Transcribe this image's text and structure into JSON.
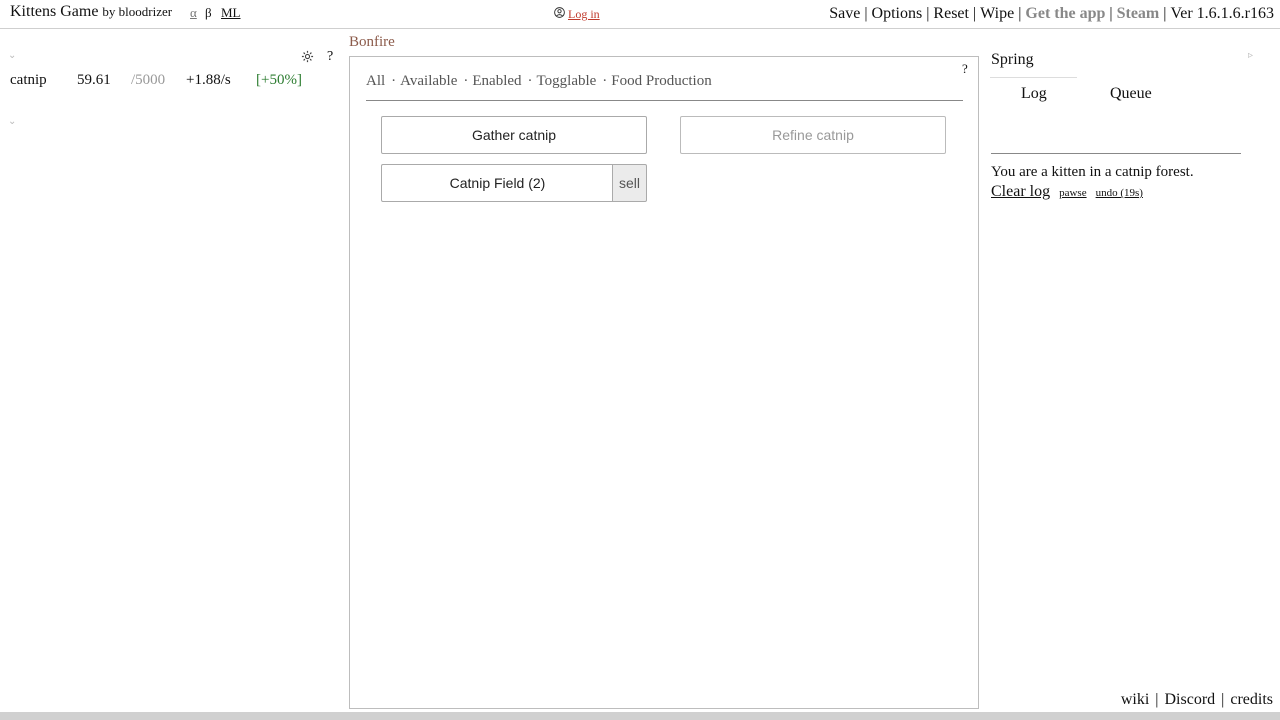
{
  "topbar": {
    "title": "Kittens Game",
    "by": "by bloodrizer",
    "alpha": "α",
    "beta": "β",
    "ml": "ML",
    "login": "Log in",
    "menu": {
      "save": "Save",
      "options": "Options",
      "reset": "Reset",
      "wipe": "Wipe",
      "get_app": "Get the app",
      "steam": "Steam",
      "version": "Ver 1.6.1.6.r163",
      "separator": "|"
    }
  },
  "left": {
    "help": "?",
    "resources": [
      {
        "name": "catnip",
        "value": "59.61",
        "max": "/5000",
        "rate": "+1.88/s",
        "bonus": "[+50%]"
      }
    ]
  },
  "bonfire": {
    "title": "Bonfire",
    "help": "?",
    "filters": [
      "All",
      "Available",
      "Enabled",
      "Togglable",
      "Food Production"
    ],
    "filter_separator": "·",
    "buttons": {
      "gather": "Gather catnip",
      "refine": "Refine catnip",
      "field": "Catnip Field (2)",
      "sell": "sell"
    }
  },
  "right": {
    "season": "Spring",
    "tabs": {
      "log": "Log",
      "queue": "Queue"
    },
    "log_message": "You are a kitten in a catnip forest.",
    "clear_log": "Clear log",
    "pawse": "pawse",
    "undo": "undo (19s)"
  },
  "footer": {
    "wiki": "wiki",
    "discord": "Discord",
    "credits": "credits",
    "separator": "|"
  },
  "colors": {
    "bonus_green": "#2e7d32",
    "login_red": "#c0392b",
    "title_brown": "#8b5a4a"
  }
}
